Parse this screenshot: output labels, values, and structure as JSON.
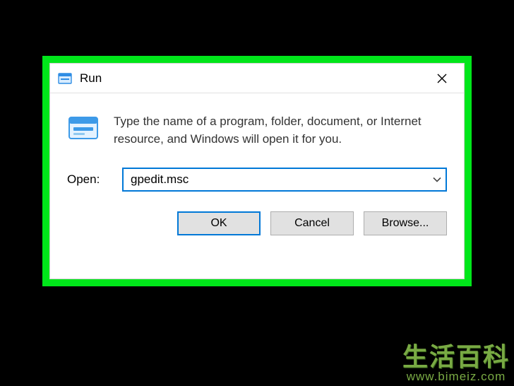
{
  "dialog": {
    "title": "Run",
    "description": "Type the name of a program, folder, document, or Internet resource, and Windows will open it for you.",
    "open_label": "Open:",
    "open_value": "gpedit.msc",
    "buttons": {
      "ok": "OK",
      "cancel": "Cancel",
      "browse": "Browse..."
    }
  },
  "watermark": {
    "title": "生活百科",
    "url": "www.bimeiz.com"
  },
  "colors": {
    "accent": "#0078d7",
    "frame": "#00e61a"
  }
}
